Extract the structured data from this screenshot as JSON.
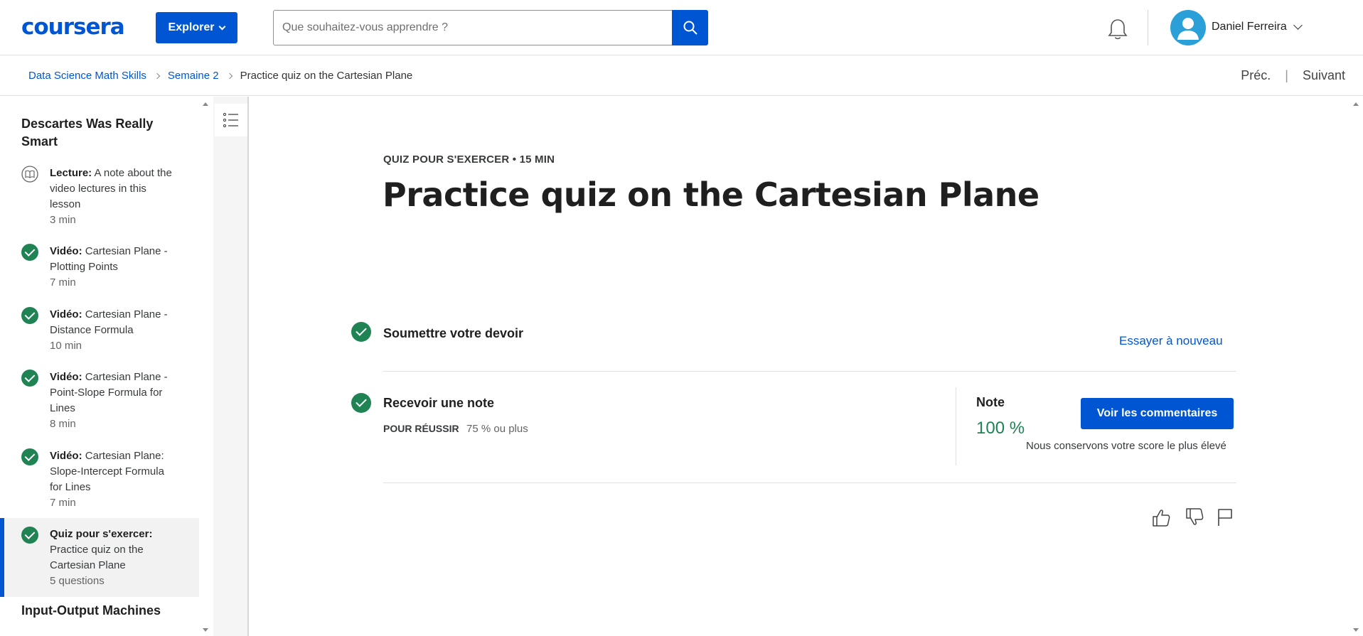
{
  "header": {
    "logo": "coursera",
    "explore_label": "Explorer",
    "search_placeholder": "Que souhaitez-vous apprendre ?",
    "user_name": "Daniel Ferreira",
    "brand_color": "#0056d2"
  },
  "breadcrumb": {
    "items": [
      "Data Science Math Skills",
      "Semaine 2",
      "Practice quiz on the Cartesian Plane"
    ],
    "prev_label": "Préc.",
    "separator": "|",
    "next_label": "Suivant"
  },
  "sidebar": {
    "section_title": "Descartes Was Really Smart",
    "items": [
      {
        "type": "Lecture:",
        "title": "A note about the video lectures in this lesson",
        "meta": "3 min",
        "icon": "book-icon",
        "completed": false
      },
      {
        "type": "Vidéo:",
        "title": "Cartesian Plane - Plotting Points",
        "meta": "7 min",
        "icon": "check-circle-icon",
        "completed": true
      },
      {
        "type": "Vidéo:",
        "title": "Cartesian Plane - Distance Formula",
        "meta": "10 min",
        "icon": "check-circle-icon",
        "completed": true
      },
      {
        "type": "Vidéo:",
        "title": "Cartesian Plane - Point-Slope Formula for Lines",
        "meta": "8 min",
        "icon": "check-circle-icon",
        "completed": true
      },
      {
        "type": "Vidéo:",
        "title": "Cartesian Plane: Slope-Intercept Formula for Lines",
        "meta": "7 min",
        "icon": "check-circle-icon",
        "completed": true
      },
      {
        "type": "Quiz pour s'exercer:",
        "title": "Practice quiz on the Cartesian Plane",
        "meta": "5 questions",
        "icon": "check-circle-icon",
        "completed": true,
        "active": true
      }
    ],
    "next_section_title": "Input-Output Machines"
  },
  "main": {
    "kicker": "QUIZ POUR S'EXERCER • 15 MIN",
    "title": "Practice quiz on the Cartesian Plane",
    "submit_step": "Soumettre votre devoir",
    "retry_label": "Essayer à nouveau",
    "grade_step": "Recevoir une note",
    "pass_label": "POUR RÉUSSIR",
    "pass_value": "75 % ou plus",
    "grade_label": "Note",
    "grade_value": "100 %",
    "view_feedback_label": "Voir les commentaires",
    "keep_note": "Nous conservons votre score le plus élevé",
    "success_color": "#1f8354"
  }
}
